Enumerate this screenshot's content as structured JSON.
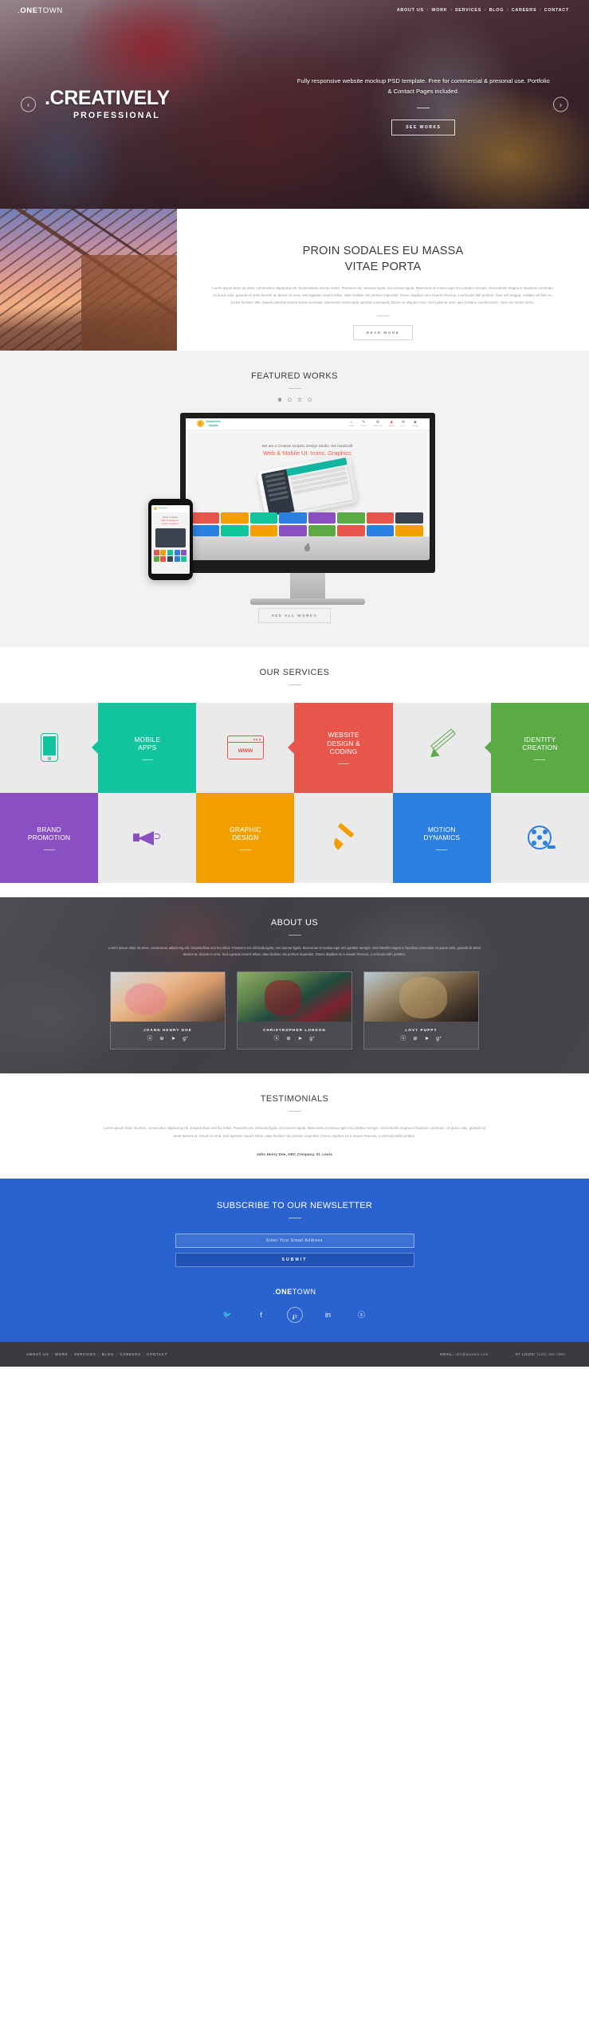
{
  "brand": {
    "dot": ".",
    "bold": "ONE",
    "light": "TOWN"
  },
  "nav": {
    "items": [
      "ABOUT US",
      "WORK",
      "SERVICES",
      "BLOG",
      "CAREERS",
      "CONTACT"
    ],
    "separator": "/"
  },
  "hero": {
    "title_dot": ".",
    "title": "CREATIVELY",
    "subtitle": "PROFESSIONAL",
    "description": "Fully responsive website mockup PSD template. Free for commercial & presonal use.  Portfolio & Contact Pages included.",
    "cta": "SEE WORKS",
    "prev_icon": "chevron-left-icon",
    "next_icon": "chevron-right-icon"
  },
  "intro": {
    "title_line1": "PROIN SODALES EU MASSA",
    "title_line2": "VITAE PORTA",
    "body": "Lorem ipsum dolor sit amet, consectetur adipiscing elit. Suspendisse sed leo tellus. Praesent nec vehicula ligula, non laoreet ligula. Maecenas at massa eget orci porttitor semper. Sed lobortis magna in faucibus commodo. Ut purus odio, gravida sit amet laoreet at, dictum et urna. Sed egestas mauris tellus, vitae facilisis nisi pretium imperdiet. Donec dapibus mi a mauris rhoncus, a vehicula nibh porttitor. Duis nisl magna, sodales vel felis eu, luctus facilisis nibh. Mauris placerat viverra lectus at ornare. Maecenas malesuada egestas consequat. Donec et aliquam eros. Sed pulvinar nunc quis tristique condimentum. Sed nec metus lorem.",
    "cta": "READ MORE"
  },
  "featured": {
    "title": "FEATURED WORKS",
    "dots": [
      true,
      false,
      false,
      false
    ],
    "cta": "SEE ALL WORKS",
    "mockup": {
      "brand_line1": "DreamView",
      "brand_line2": "Studios",
      "nav": [
        {
          "glyph": "⌂",
          "label": "HOME",
          "active": false
        },
        {
          "glyph": "✎",
          "label": "WORKS",
          "active": false
        },
        {
          "glyph": "⚙",
          "label": "SERVICES",
          "active": false
        },
        {
          "glyph": "♟",
          "label": "ABOUT",
          "active": true
        },
        {
          "glyph": "✉",
          "label": "BLOG",
          "active": false
        },
        {
          "glyph": "■",
          "label": "PRESS",
          "active": false
        }
      ],
      "headline": "We are a Creative Graphic Design Studio. We handcraft",
      "subhead": "Web & Mobile UI. Icons. Graphics",
      "tile_colors": [
        "#e8554a",
        "#f2a000",
        "#12c49e",
        "#2b7fe0",
        "#8b4fc4",
        "#5aab44",
        "#e8554a",
        "#3b4350",
        "#2b7fe0",
        "#12c49e",
        "#f2a000",
        "#8b4fc4",
        "#5aab44",
        "#e8554a",
        "#2b7fe0",
        "#f2a000"
      ]
    }
  },
  "services": {
    "title": "OUR SERVICES",
    "items": [
      {
        "label": "MOBILE\nAPPS",
        "color": "#12c49e",
        "icon": "smartphone-icon",
        "icon_side": "left"
      },
      {
        "label": "WEBSITE\nDESIGN &\nCODING",
        "color": "#e8554a",
        "icon": "browser-www-icon",
        "icon_side": "left"
      },
      {
        "label": "IDENTITY\nCREATION",
        "color": "#5aab44",
        "icon": "pencil-icon",
        "icon_side": "left"
      },
      {
        "label": "BRAND\nPROMOTION",
        "color": "#8b4fc4",
        "icon": "megaphone-icon",
        "icon_side": "right"
      },
      {
        "label": "GRAPHIC\nDESIGN",
        "color": "#f2a000",
        "icon": "paintbrush-icon",
        "icon_side": "right"
      },
      {
        "label": "MOTION\nDYNAMICS",
        "color": "#2b7fe0",
        "icon": "film-reel-icon",
        "icon_side": "right"
      }
    ]
  },
  "about": {
    "title": "ABOUT US",
    "body": "Lorem ipsum dolor sit amet, consectetur adipiscing elit. Suspendisse sed leo tellus. Praesent nec vehicula ligula, non laoreet ligula. Maecenas at massa eget orci porttitor semper. Sed lobortis magna in faucibus commodo. Ut purus odio, gravida sit amet laoreet at, dictum et urna. Sed egestas mauris tellus, vitae facilisis nisi pretium imperdiet. Donec dapibus mi a mauris rhoncus, a vehicula nibh porttitor.",
    "team": [
      {
        "name": "JOANN HENRY DOE",
        "social": [
          "ⓢ",
          "⊛",
          "➤",
          "g⁺"
        ]
      },
      {
        "name": "CHRISTROPHER LONDON",
        "social": [
          "ⓢ",
          "⊛",
          "➤",
          "g⁺"
        ]
      },
      {
        "name": "LOVY PUPPY",
        "social": [
          "ⓢ",
          "⊛",
          "➤",
          "g⁺"
        ]
      }
    ]
  },
  "testimonials": {
    "title": "TESTIMONIALS",
    "quote": "Lorem ipsum dolor sit amet, consectetur adipiscing elit. Suspendisse sed leo tellus. Praesent nec vehicula ligula, non laoreet ligula. Maecenas at massa eget orci porttitor semper. Sed lobortis magna in faucibus commodo. Ut purus odio, gravida sit amet laoreet at, dictum et urna. Sed egestas mauris tellus, vitae facilisis nisi pretium imperdiet. Donec dapibus mi a mauris rhoncus, a vehicula nibh porttitor.",
    "author": "John Henry Doe, ABC Company, St. Louis"
  },
  "newsletter": {
    "title": "SUBSCRIBE TO OUR NEWSLETTER",
    "placeholder": "Enter Your Email Address",
    "value": "",
    "submit": "SUBMIT",
    "social": [
      {
        "icon": "twitter-icon",
        "glyph": "🐦",
        "ring": false
      },
      {
        "icon": "facebook-icon",
        "glyph": "f",
        "ring": false
      },
      {
        "icon": "pinterest-icon",
        "glyph": "℘",
        "ring": true
      },
      {
        "icon": "linkedin-icon",
        "glyph": "in",
        "ring": false
      },
      {
        "icon": "skype-icon",
        "glyph": "ⓢ",
        "ring": false
      }
    ]
  },
  "footer": {
    "nav": [
      "ABOUT US",
      "WORK",
      "SERVICES",
      "BLOG",
      "CAREERS",
      "CONTACT"
    ],
    "separator": "/",
    "email_label": "EMAIL:",
    "email": "info@domain.com",
    "phone_label": "ST LOUIS:",
    "phone": "(123) 456 7890"
  },
  "colors": {
    "accent_blue": "#2a62cf",
    "teal": "#12c49e",
    "red": "#e8554a",
    "green": "#5aab44",
    "purple": "#8b4fc4",
    "orange": "#f2a000",
    "blue": "#2b7fe0",
    "dark": "#3a3a40"
  }
}
